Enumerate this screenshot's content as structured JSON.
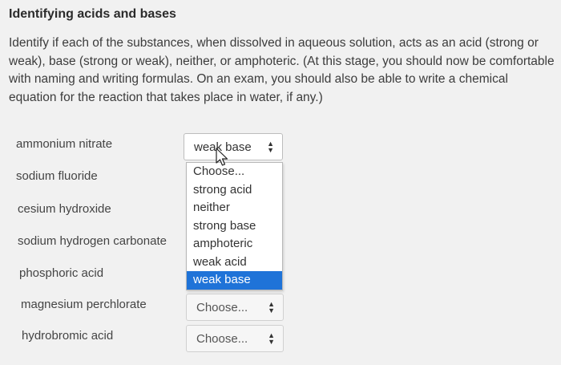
{
  "title": "Identifying acids and bases",
  "instructions": "Identify if each of the substances, when dissolved in aqueous solution, acts as an acid (strong or weak), base (strong or weak), neither, or amphoteric. (At this stage, you should now be comfortable with naming and writing formulas. On an exam, you should also be able to write a chemical equation for the reaction that takes place in water, if any.)",
  "rows": [
    {
      "substance": "ammonium nitrate",
      "selected": "weak base"
    },
    {
      "substance": "sodium fluoride",
      "selected": ""
    },
    {
      "substance": "cesium hydroxide",
      "selected": ""
    },
    {
      "substance": "sodium hydrogen carbonate",
      "selected": ""
    },
    {
      "substance": "phosphoric acid",
      "selected": ""
    },
    {
      "substance": "magnesium perchlorate",
      "selected": "Choose..."
    },
    {
      "substance": "hydrobromic acid",
      "selected": "Choose..."
    }
  ],
  "dropdown_options": [
    "Choose...",
    "strong acid",
    "neither",
    "strong base",
    "amphoteric",
    "weak acid",
    "weak base"
  ],
  "dropdown_highlighted_index": 6,
  "colors": {
    "highlight": "#1f73d8",
    "background": "#f1f1f1"
  },
  "icons": {
    "select_arrows": "up-down-arrows-icon",
    "cursor": "mouse-pointer-icon"
  }
}
